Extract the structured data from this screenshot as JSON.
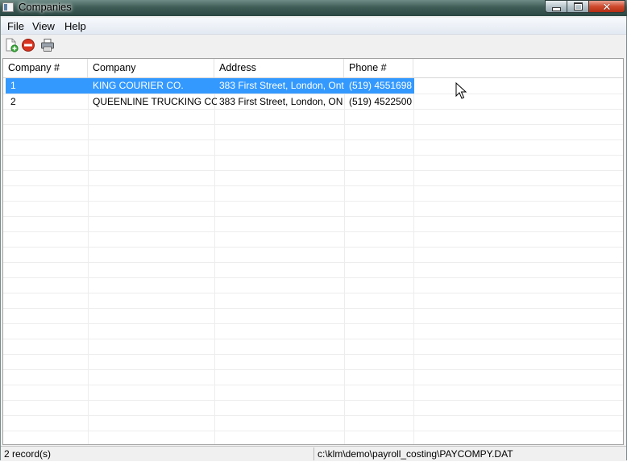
{
  "window": {
    "title": "Companies"
  },
  "menu": {
    "items": [
      "File",
      "View",
      "Help"
    ]
  },
  "toolbar": {
    "icons": [
      "add-icon",
      "delete-icon",
      "print-icon"
    ]
  },
  "table": {
    "columns": [
      "Company #",
      "Company",
      "Address",
      "Phone #"
    ],
    "rows": [
      [
        "1",
        "KING COURIER CO.",
        "383 First Street, London, Ont",
        "(519) 4551698"
      ],
      [
        "2",
        "QUEENLINE TRUCKING CO.",
        "383 First Street, London, ON",
        "(519) 4522500"
      ]
    ],
    "selected_row": 0
  },
  "status": {
    "record_count": "2 record(s)",
    "file_path": "c:\\klm\\demo\\payroll_costing\\PAYCOMPY.DAT"
  },
  "colors": {
    "selection": "#3399ff",
    "close_button": "#cf4a2e"
  }
}
